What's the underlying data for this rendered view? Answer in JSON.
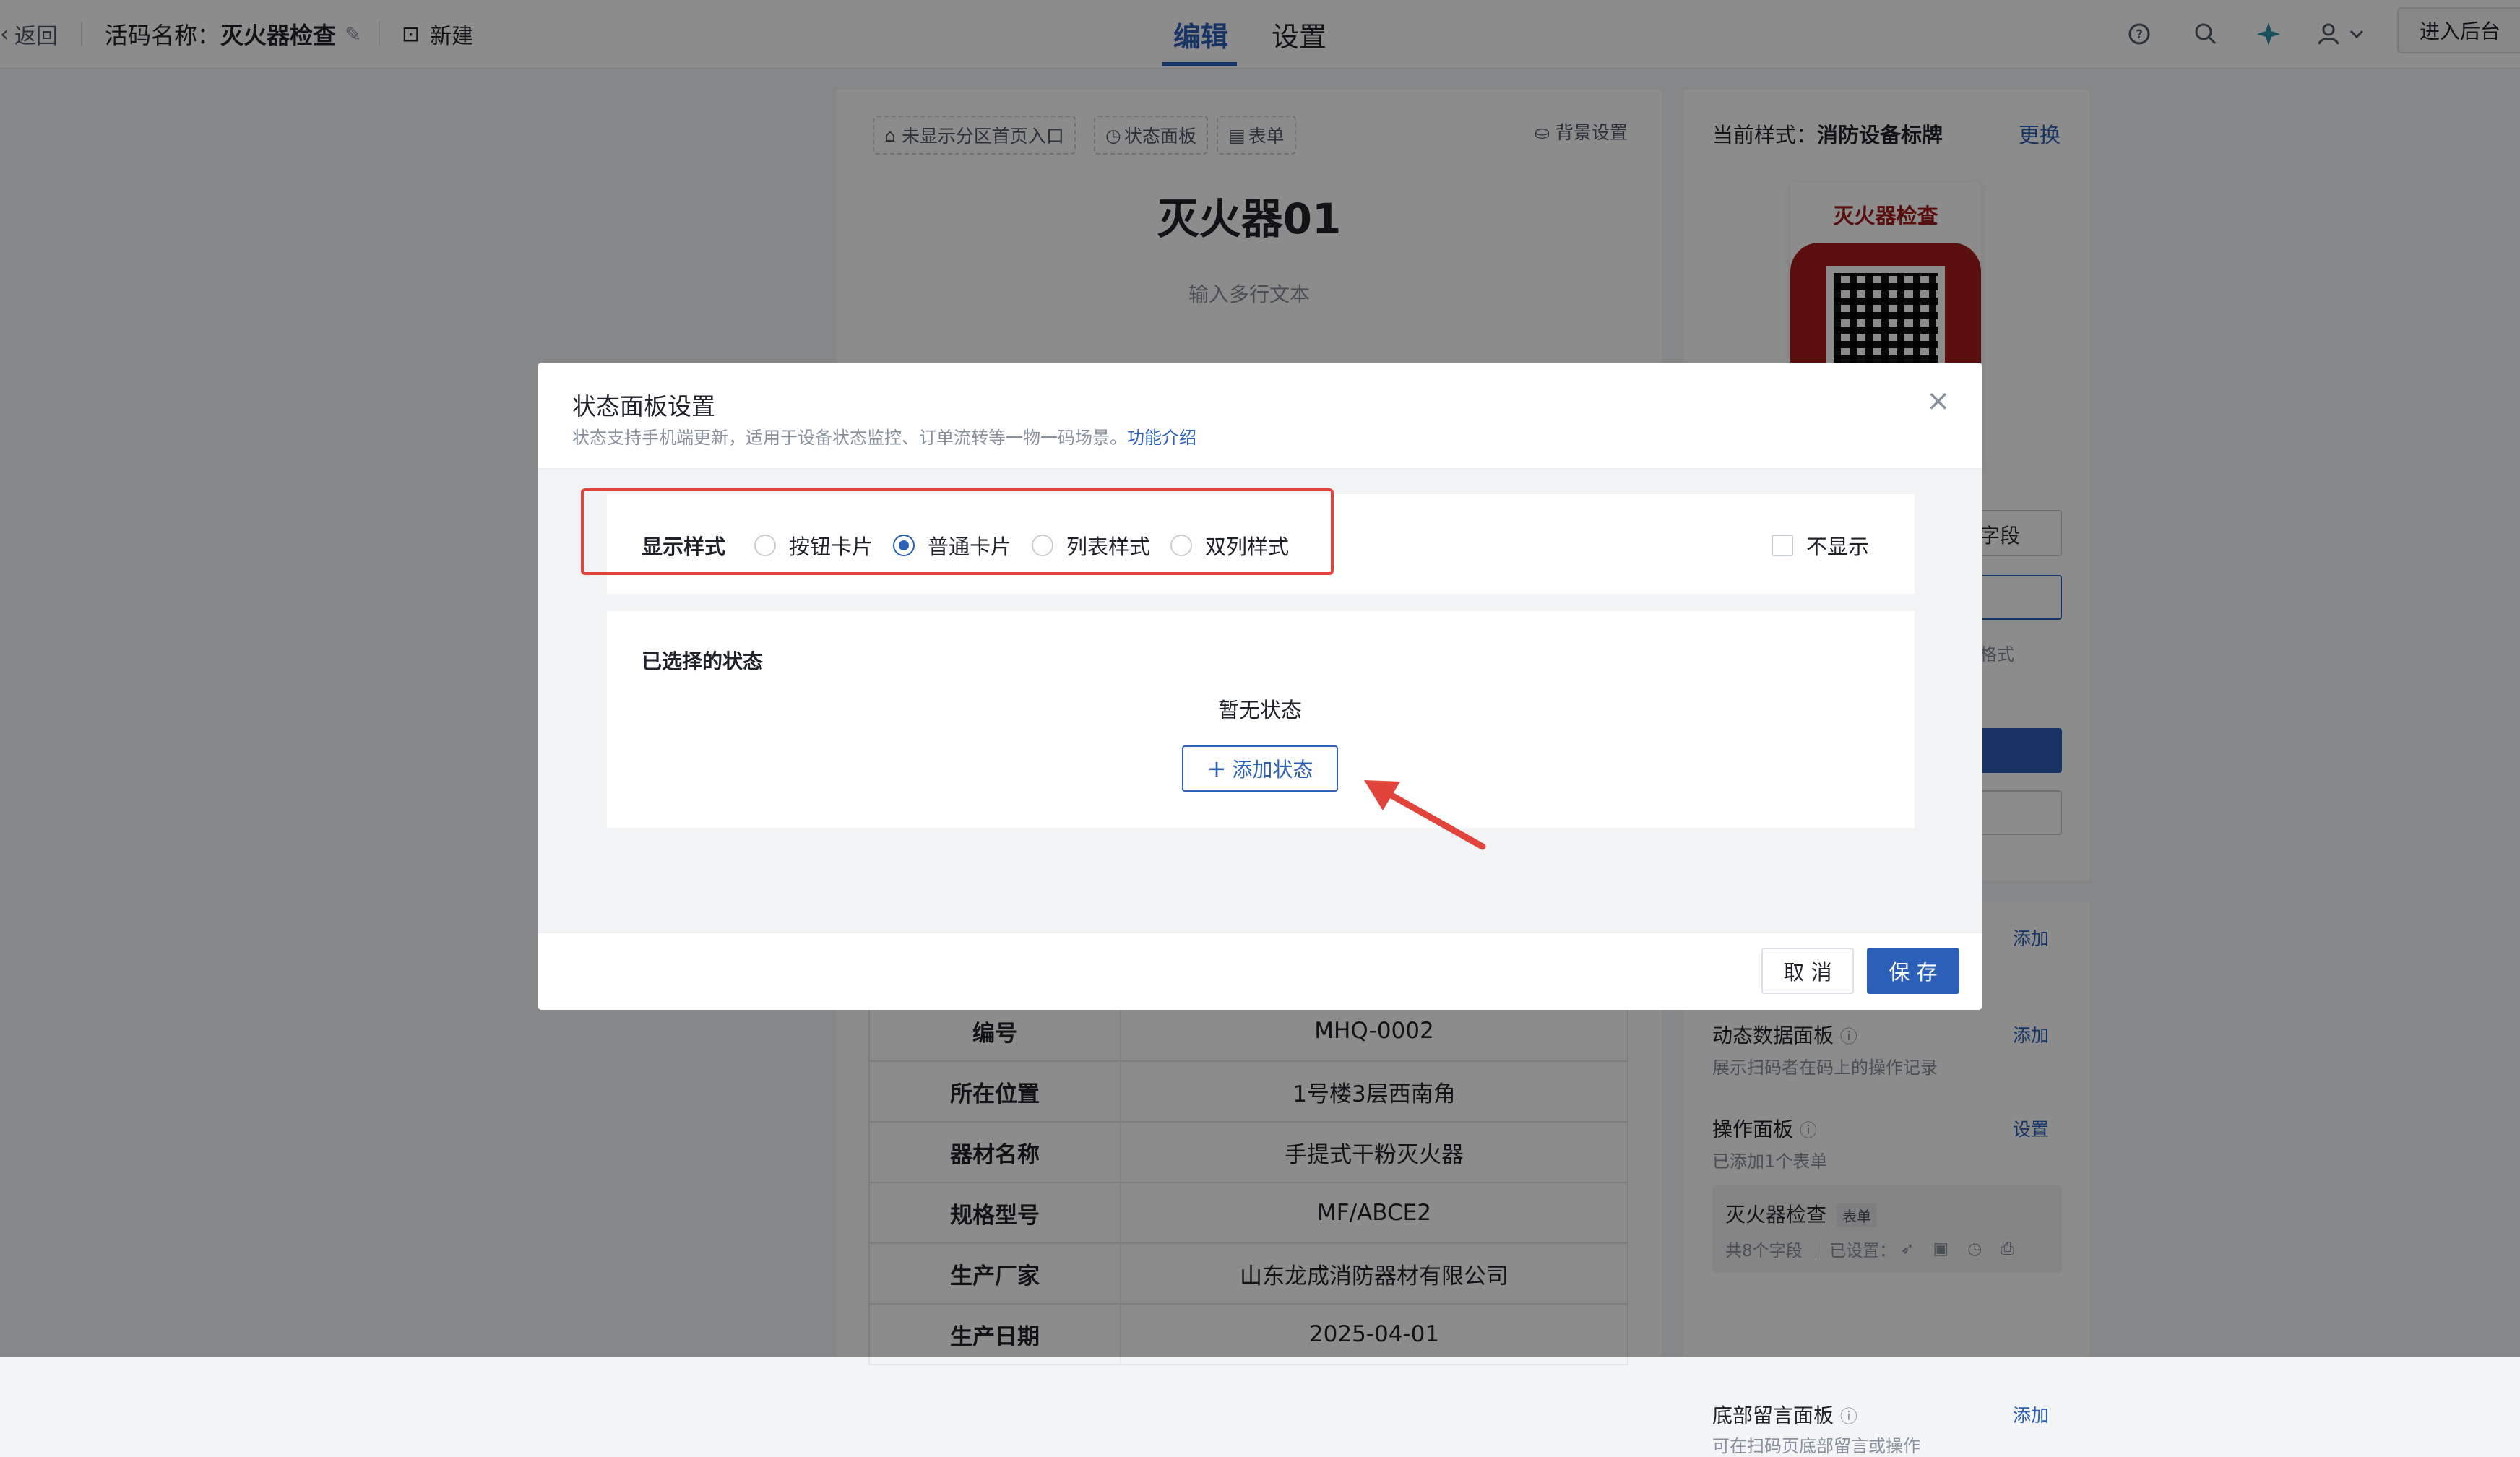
{
  "topbar": {
    "back_label": "返回",
    "code_name_prefix": "活码名称：",
    "code_name": "灭火器检查",
    "new_label": "新建",
    "tabs": [
      {
        "label": "编辑"
      },
      {
        "label": "设置"
      }
    ],
    "enter_admin_label": "进入后台"
  },
  "editor": {
    "chips": [
      "未显示分区首页入口",
      "状态面板",
      "表单"
    ],
    "bg_settings_label": "背景设置",
    "title": "灭火器01",
    "subtitle": "输入多行文本",
    "table": [
      {
        "key": "编号",
        "value": "MHQ-0002"
      },
      {
        "key": "所在位置",
        "value": "1号楼3层西南角"
      },
      {
        "key": "器材名称",
        "value": "手提式干粉灭火器"
      },
      {
        "key": "规格型号",
        "value": "MF/ABCE2"
      },
      {
        "key": "生产厂家",
        "value": "山东龙成消防器材有限公司"
      },
      {
        "key": "生产日期",
        "value": "2025-04-01"
      }
    ]
  },
  "right_panel": {
    "current_style_prefix": "当前样式：",
    "current_style": "消防设备标牌",
    "change_label": "更换",
    "preview_title": "灭火器检查",
    "field_partial": "字段",
    "format_partial": "格式",
    "add_label": "添加",
    "dynamic_panel_title": "动态数据面板",
    "dynamic_panel_desc": "展示扫码者在码上的操作记录",
    "op_panel_title": "操作面板",
    "op_panel_desc": "已添加1个表单",
    "set_label": "设置",
    "form_name": "灭火器检查",
    "form_tag": "表单",
    "form_meta": "共8个字段 ｜ 已设置：",
    "bottom_panel_title": "底部留言面板",
    "bottom_panel_desc": "可在扫码页底部留言或操作"
  },
  "modal": {
    "title": "状态面板设置",
    "desc": "状态支持手机端更新，适用于设备状态监控、订单流转等一物一码场景。",
    "desc_link": "功能介绍",
    "display_style_label": "显示样式",
    "options": [
      "按钮卡片",
      "普通卡片",
      "列表样式",
      "双列样式"
    ],
    "selected_option": "普通卡片",
    "hide_label": "不显示",
    "selected_title": "已选择的状态",
    "empty_text": "暂无状态",
    "add_state_label": "添加状态",
    "cancel_label": "取 消",
    "save_label": "保 存"
  },
  "colors": {
    "accent": "#2b5fb8",
    "highlight": "#e0443a",
    "label_red": "#a61b1b"
  }
}
